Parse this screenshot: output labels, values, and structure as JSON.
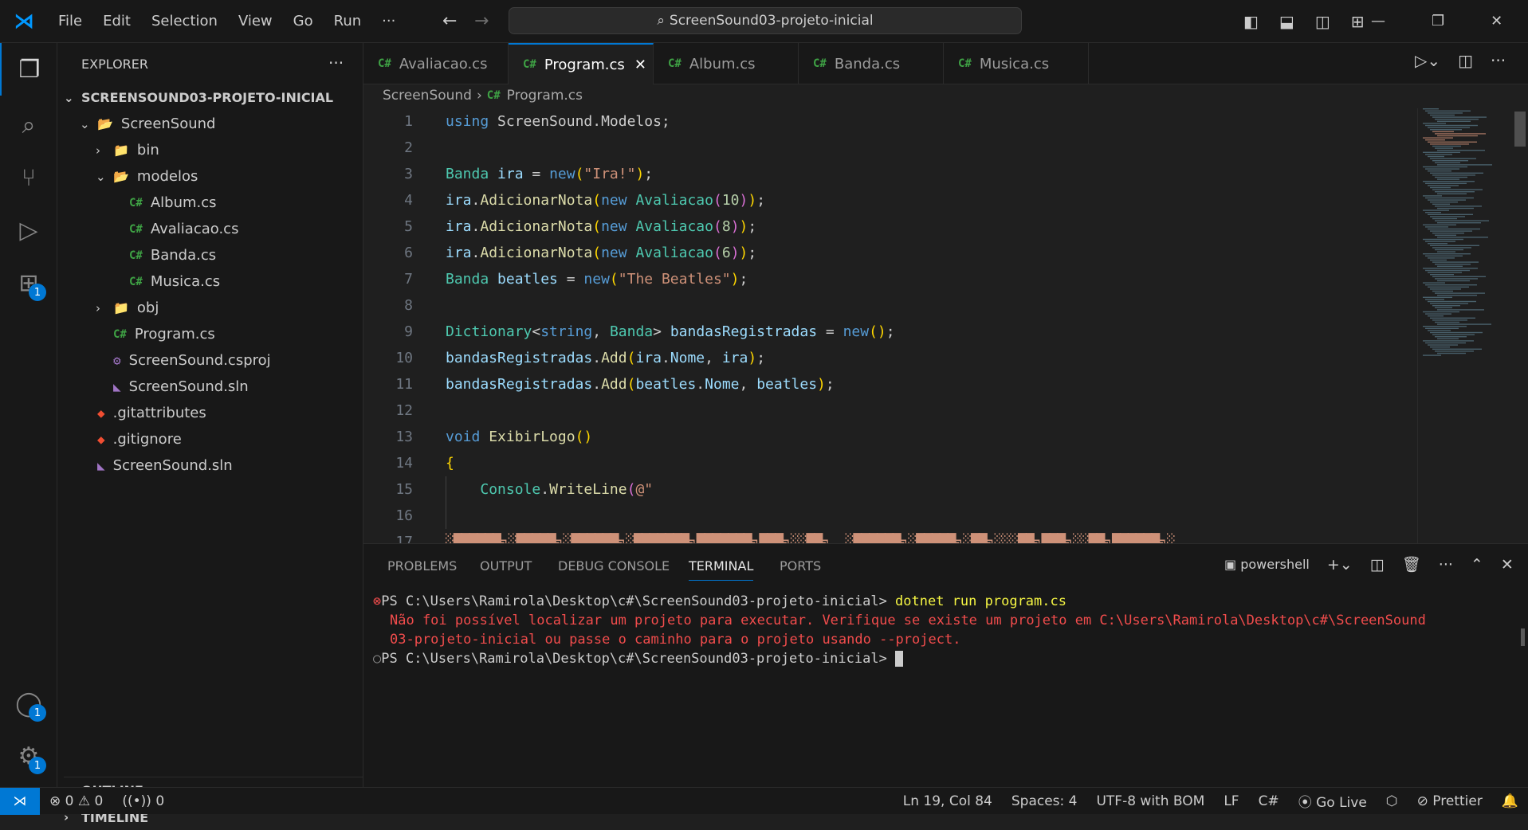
{
  "menu": [
    "File",
    "Edit",
    "Selection",
    "View",
    "Go",
    "Run",
    "···"
  ],
  "search": "ScreenSound03-projeto-inicial",
  "explorer": {
    "title": "EXPLORER",
    "root": "SCREENSOUND03-PROJETO-INICIAL",
    "items": [
      {
        "label": "ScreenSound",
        "kind": "folder-open",
        "depth": 1
      },
      {
        "label": "bin",
        "kind": "folder",
        "depth": 2
      },
      {
        "label": "modelos",
        "kind": "folder-open",
        "depth": 2
      },
      {
        "label": "Album.cs",
        "kind": "cs",
        "depth": 3
      },
      {
        "label": "Avaliacao.cs",
        "kind": "cs",
        "depth": 3
      },
      {
        "label": "Banda.cs",
        "kind": "cs",
        "depth": 3
      },
      {
        "label": "Musica.cs",
        "kind": "cs",
        "depth": 3
      },
      {
        "label": "obj",
        "kind": "folder",
        "depth": 2
      },
      {
        "label": "Program.cs",
        "kind": "cs",
        "depth": 2
      },
      {
        "label": "ScreenSound.csproj",
        "kind": "csproj",
        "depth": 2
      },
      {
        "label": "ScreenSound.sln",
        "kind": "sln",
        "depth": 2
      },
      {
        "label": ".gitattributes",
        "kind": "git",
        "depth": 1
      },
      {
        "label": ".gitignore",
        "kind": "git",
        "depth": 1
      },
      {
        "label": "ScreenSound.sln",
        "kind": "sln",
        "depth": 1
      }
    ],
    "outline": "OUTLINE",
    "timeline": "TIMELINE"
  },
  "tabs": [
    {
      "label": "Avaliacao.cs"
    },
    {
      "label": "Program.cs",
      "active": true
    },
    {
      "label": "Album.cs"
    },
    {
      "label": "Banda.cs"
    },
    {
      "label": "Musica.cs"
    }
  ],
  "breadcrumb": [
    "ScreenSound",
    "Program.cs"
  ],
  "code": [
    [
      [
        "kw",
        "using "
      ],
      [
        "pl",
        "ScreenSound.Modelos;"
      ]
    ],
    [],
    [
      [
        "ty",
        "Banda "
      ],
      [
        "va",
        "ira"
      ],
      [
        "pl",
        " = "
      ],
      [
        "kw",
        "new"
      ],
      [
        "br",
        "("
      ],
      [
        "st",
        "\"Ira!\""
      ],
      [
        "br",
        ")"
      ],
      [
        "pl",
        ";"
      ]
    ],
    [
      [
        "va",
        "ira"
      ],
      [
        "pl",
        "."
      ],
      [
        "fn",
        "AdicionarNota"
      ],
      [
        "br",
        "("
      ],
      [
        "kw",
        "new "
      ],
      [
        "ty",
        "Avaliacao"
      ],
      [
        "br2",
        "("
      ],
      [
        "nu",
        "10"
      ],
      [
        "br2",
        ")"
      ],
      [
        "br",
        ")"
      ],
      [
        "pl",
        ";"
      ]
    ],
    [
      [
        "va",
        "ira"
      ],
      [
        "pl",
        "."
      ],
      [
        "fn",
        "AdicionarNota"
      ],
      [
        "br",
        "("
      ],
      [
        "kw",
        "new "
      ],
      [
        "ty",
        "Avaliacao"
      ],
      [
        "br2",
        "("
      ],
      [
        "nu",
        "8"
      ],
      [
        "br2",
        ")"
      ],
      [
        "br",
        ")"
      ],
      [
        "pl",
        ";"
      ]
    ],
    [
      [
        "va",
        "ira"
      ],
      [
        "pl",
        "."
      ],
      [
        "fn",
        "AdicionarNota"
      ],
      [
        "br",
        "("
      ],
      [
        "kw",
        "new "
      ],
      [
        "ty",
        "Avaliacao"
      ],
      [
        "br2",
        "("
      ],
      [
        "nu",
        "6"
      ],
      [
        "br2",
        ")"
      ],
      [
        "br",
        ")"
      ],
      [
        "pl",
        ";"
      ]
    ],
    [
      [
        "ty",
        "Banda "
      ],
      [
        "va",
        "beatles"
      ],
      [
        "pl",
        " = "
      ],
      [
        "kw",
        "new"
      ],
      [
        "br",
        "("
      ],
      [
        "st",
        "\"The Beatles\""
      ],
      [
        "br",
        ")"
      ],
      [
        "pl",
        ";"
      ]
    ],
    [],
    [
      [
        "ty",
        "Dictionary"
      ],
      [
        "pl",
        "<"
      ],
      [
        "kw",
        "string"
      ],
      [
        "pl",
        ", "
      ],
      [
        "ty",
        "Banda"
      ],
      [
        "pl",
        "> "
      ],
      [
        "va",
        "bandasRegistradas"
      ],
      [
        "pl",
        " = "
      ],
      [
        "kw",
        "new"
      ],
      [
        "br",
        "()"
      ],
      [
        "pl",
        ";"
      ]
    ],
    [
      [
        "va",
        "bandasRegistradas"
      ],
      [
        "pl",
        "."
      ],
      [
        "fn",
        "Add"
      ],
      [
        "br",
        "("
      ],
      [
        "va",
        "ira"
      ],
      [
        "pl",
        "."
      ],
      [
        "va",
        "Nome"
      ],
      [
        "pl",
        ", "
      ],
      [
        "va",
        "ira"
      ],
      [
        "br",
        ")"
      ],
      [
        "pl",
        ";"
      ]
    ],
    [
      [
        "va",
        "bandasRegistradas"
      ],
      [
        "pl",
        "."
      ],
      [
        "fn",
        "Add"
      ],
      [
        "br",
        "("
      ],
      [
        "va",
        "beatles"
      ],
      [
        "pl",
        "."
      ],
      [
        "va",
        "Nome"
      ],
      [
        "pl",
        ", "
      ],
      [
        "va",
        "beatles"
      ],
      [
        "br",
        ")"
      ],
      [
        "pl",
        ";"
      ]
    ],
    [],
    [
      [
        "kw",
        "void "
      ],
      [
        "fn",
        "ExibirLogo"
      ],
      [
        "br",
        "()"
      ]
    ],
    [
      [
        "br",
        "{"
      ]
    ],
    [
      [
        "pl",
        "    "
      ],
      [
        "ty",
        "Console"
      ],
      [
        "pl",
        "."
      ],
      [
        "fn",
        "WriteLine"
      ],
      [
        "br2",
        "("
      ],
      [
        "st",
        "@\""
      ]
    ],
    [],
    [
      [
        "art",
        "░██████╗░█████╗░██████╗░███████╗███████╗███╗░░██╗  ░██████╗░█████╗░██╗░░░██╗███╗░░██╗██████╗░"
      ]
    ],
    [
      [
        "art",
        "██╔════╝██╔══██╗██╔══██╗██╔════╝██╔════╝████╗░██║  ██╔════╝██╔══██╗██║░░░██║████╗░██║██╔══██╗"
      ]
    ],
    [
      [
        "art",
        "╚█████╗░██║░░╚═╝██████╔╝█████╗░░█████╗░░██╔██╗██║  ╚█████╗░██║░░██║██║░░░██║██╔██╗██║██║░░██║"
      ]
    ]
  ],
  "panel": {
    "tabs": [
      "PROBLEMS",
      "OUTPUT",
      "DEBUG CONSOLE",
      "TERMINAL",
      "PORTS"
    ],
    "active": "TERMINAL",
    "shell": "powershell"
  },
  "terminal": [
    {
      "prompt": "PS C:\\Users\\Ramirola\\Desktop\\c#\\ScreenSound03-projeto-inicial> ",
      "cmd": "dotnet run program.cs",
      "status": "error"
    },
    {
      "text": "Não foi possível localizar um projeto para executar. Verifique se existe um projeto em C:\\Users\\Ramirola\\Desktop\\c#\\ScreenSound",
      "error": true
    },
    {
      "text": "03-projeto-inicial ou passe o caminho para o projeto usando --project.",
      "error": true
    },
    {
      "prompt": "PS C:\\Users\\Ramirola\\Desktop\\c#\\ScreenSound03-projeto-inicial> ",
      "cmd": "",
      "status": "idle"
    }
  ],
  "status": {
    "errors": "0",
    "warnings": "0",
    "ports": "0",
    "position": "Ln 19, Col 84",
    "spaces": "Spaces: 4",
    "encoding": "UTF-8 with BOM",
    "eol": "LF",
    "language": "C#",
    "golive": "Go Live",
    "prettier": "Prettier"
  },
  "badges": {
    "extensions": "1",
    "accounts": "1",
    "settings": "1"
  },
  "colors": {
    "accent": "#0078d4",
    "error": "#f14c4c",
    "string": "#ce9178"
  }
}
